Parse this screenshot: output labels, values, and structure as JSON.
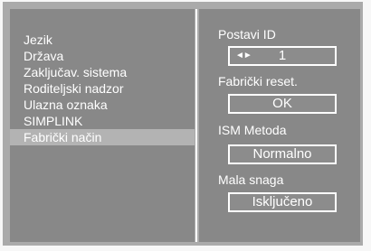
{
  "menu": {
    "items": [
      {
        "label": "Jezik",
        "selected": false
      },
      {
        "label": "Država",
        "selected": false
      },
      {
        "label": "Zaključav. sistema",
        "selected": false
      },
      {
        "label": "Roditeljski nadzor",
        "selected": false
      },
      {
        "label": "Ulazna oznaka",
        "selected": false
      },
      {
        "label": "SIMPLINK",
        "selected": false
      },
      {
        "label": "Fabrički način",
        "selected": true
      }
    ]
  },
  "settings": {
    "set_id": {
      "label": "Postavi ID",
      "value": "1",
      "arrows": "◄►"
    },
    "factory_reset": {
      "label": "Fabrički reset.",
      "value": "OK"
    },
    "ism_method": {
      "label": "ISM Metoda",
      "value": "Normalno"
    },
    "low_power": {
      "label": "Mala snaga",
      "value": "Isključeno"
    }
  }
}
